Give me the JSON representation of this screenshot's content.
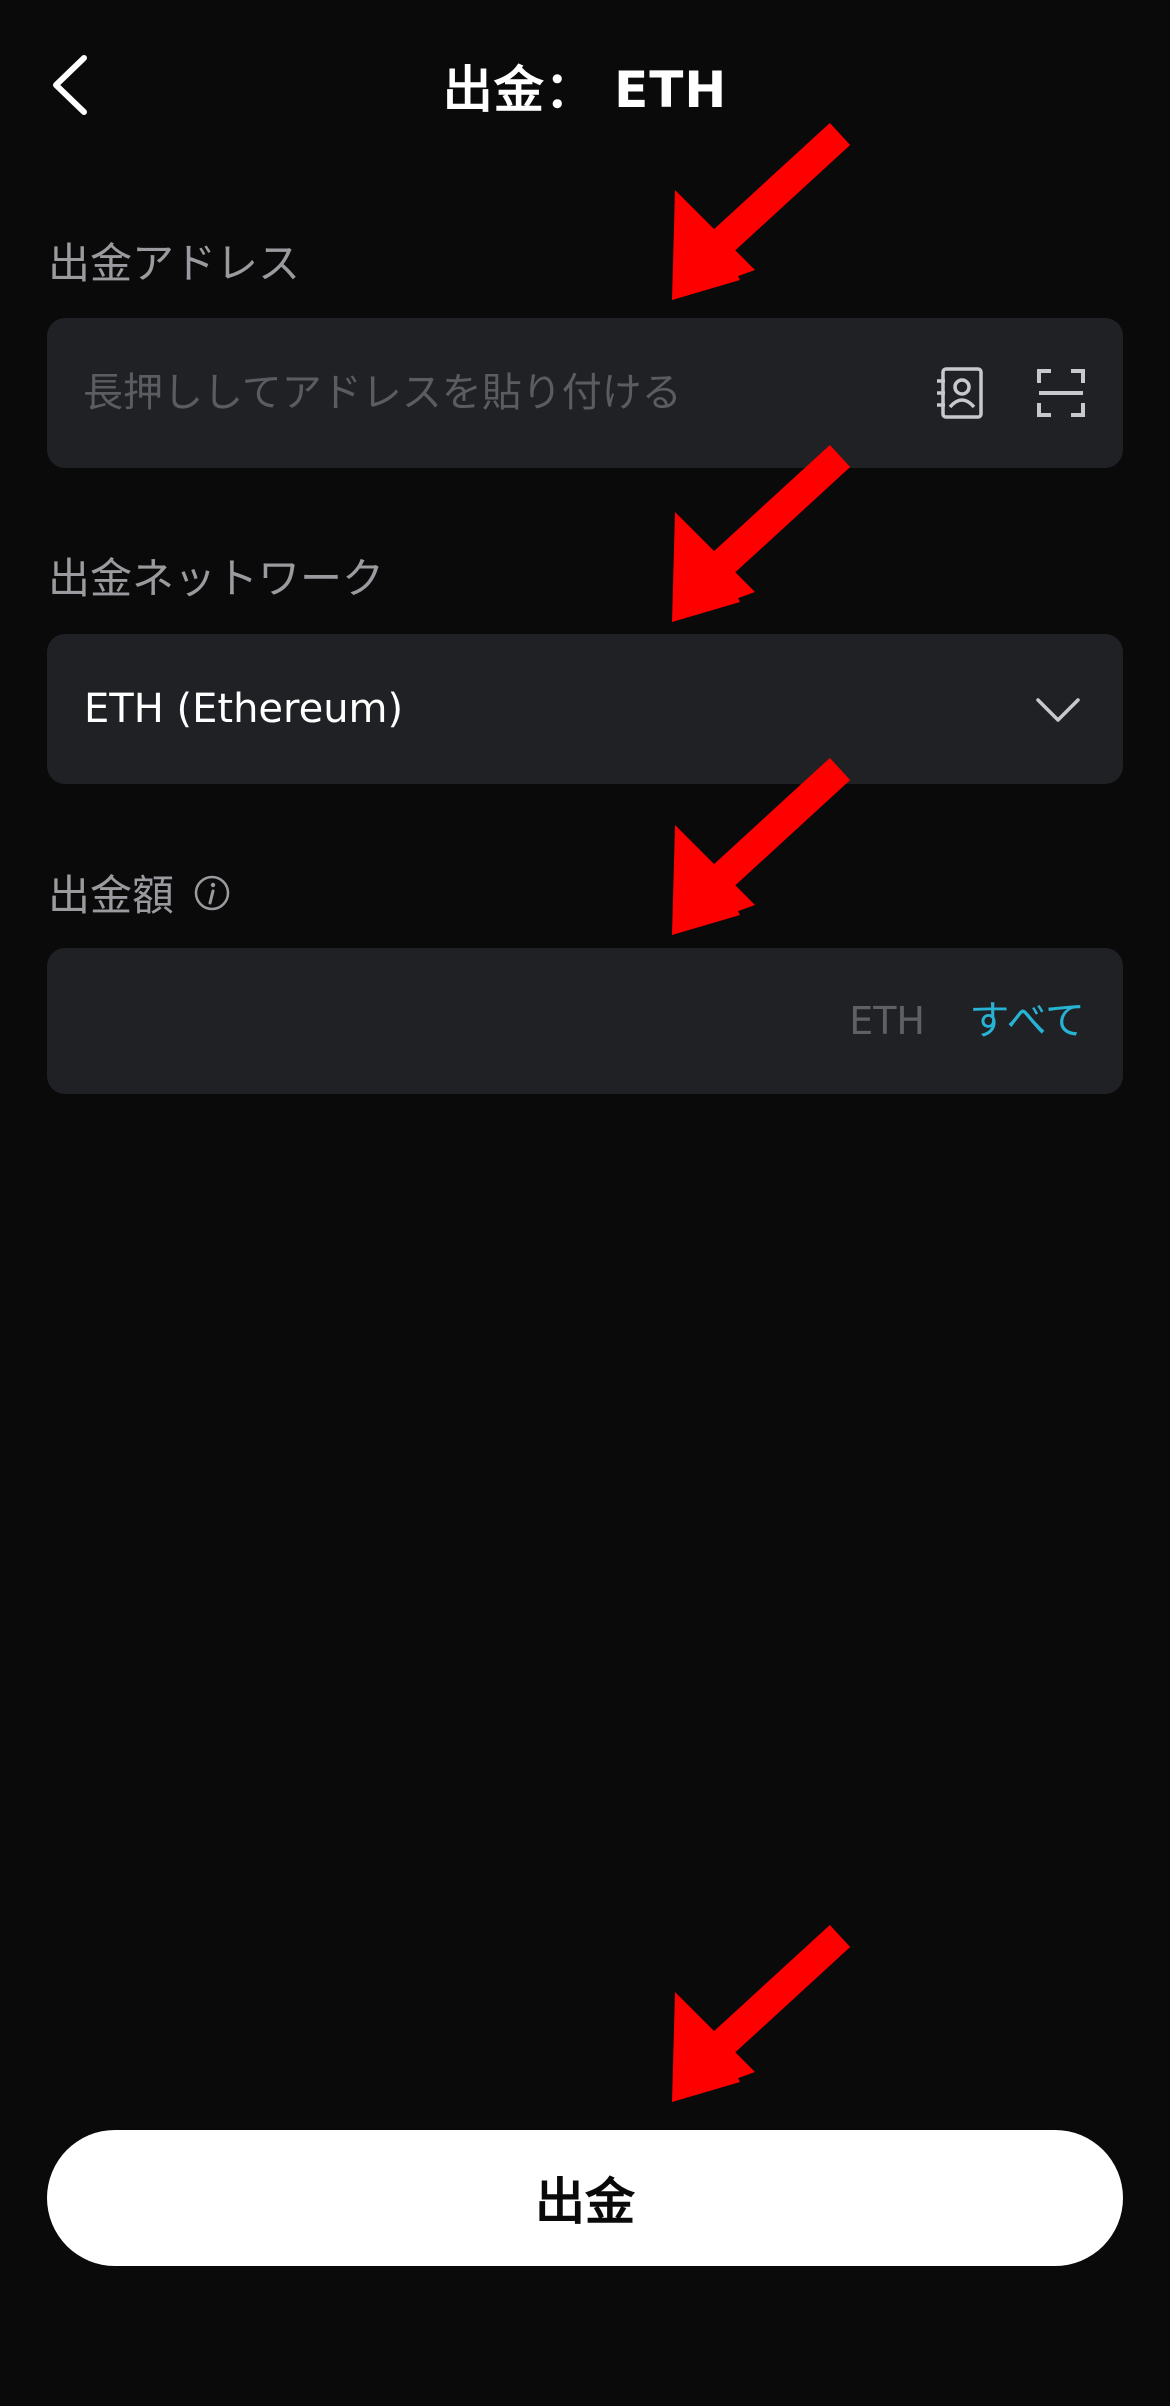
{
  "header": {
    "title": "出金： ETH",
    "back_icon": "chevron-left-icon"
  },
  "address": {
    "label": "出金アドレス",
    "placeholder": "長押ししてアドレスを貼り付ける",
    "value": "",
    "icons": [
      "address-book-icon",
      "scan-icon"
    ]
  },
  "network": {
    "label": "出金ネットワーク",
    "selected": "ETH (Ethereum)",
    "icon": "chevron-down-icon"
  },
  "amount": {
    "label": "出金額",
    "info_icon": "info-icon",
    "value": "",
    "unit": "ETH",
    "all_label": "すべて"
  },
  "submit": {
    "label": "出金"
  },
  "colors": {
    "background": "#0a0a0b",
    "field": "#202125",
    "label": "#9a9b9f",
    "accent": "#27b3d3",
    "annotation_arrow": "#ff0000",
    "button_bg": "#ffffff"
  },
  "annotations": {
    "arrow_icon": "red-arrow-icon",
    "count": 4
  }
}
